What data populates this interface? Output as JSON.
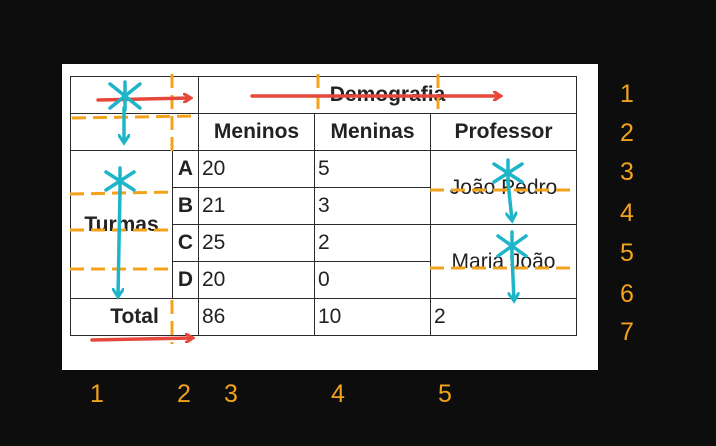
{
  "table": {
    "header": {
      "row1_group": "Demografia",
      "boys": "Meninos",
      "girls": "Meninas",
      "teacher": "Professor"
    },
    "row_group_label": "Turmas",
    "rows": [
      {
        "class": "A",
        "boys": "20",
        "girls": "5"
      },
      {
        "class": "B",
        "boys": "21",
        "girls": "3"
      },
      {
        "class": "C",
        "boys": "25",
        "girls": "2"
      },
      {
        "class": "D",
        "boys": "20",
        "girls": "0"
      }
    ],
    "teachers": [
      "João Pedro",
      "Maria João"
    ],
    "total": {
      "label": "Total",
      "boys": "86",
      "girls": "10",
      "teacher": "2"
    }
  },
  "row_numbers": [
    "1",
    "2",
    "3",
    "4",
    "5",
    "6",
    "7"
  ],
  "column_numbers": [
    "1",
    "2",
    "3",
    "4",
    "5"
  ],
  "colors": {
    "background": "#0d0d0d",
    "numbering": "#f3a21c",
    "arrow_red": "#e5483a",
    "arrow_cyan": "#1fb5c9",
    "dashes": "#f3a21c"
  }
}
